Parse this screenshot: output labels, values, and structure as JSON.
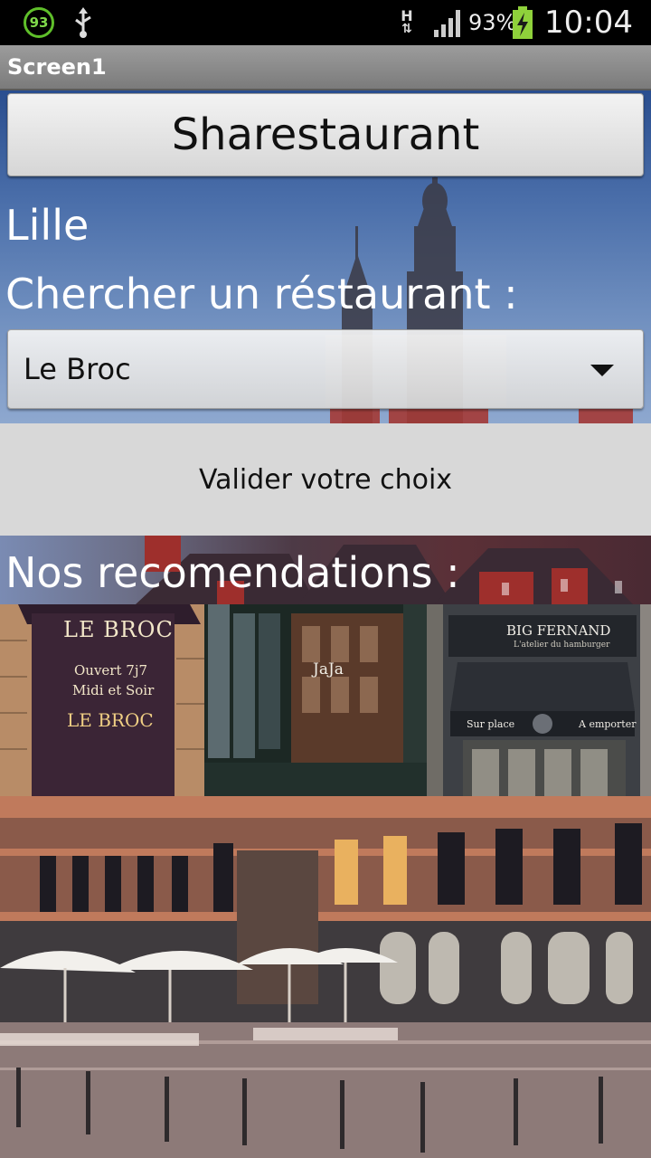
{
  "status_bar": {
    "notification_badge": "93",
    "network_type": "H",
    "battery_percent": "93%",
    "time": "10:04",
    "icons": [
      "usb-icon",
      "signal-icon",
      "battery-charging-icon"
    ]
  },
  "title_bar": {
    "title": "Screen1"
  },
  "main": {
    "app_button_label": "Sharestaurant",
    "city_label": "Lille",
    "search_label": "Chercher un réstaurant :",
    "spinner_value": "Le Broc",
    "validate_button_label": "Valider votre choix",
    "recommendations_label": "Nos recomendations :"
  },
  "thumbnails": {
    "le_broc": {
      "title": "LE BROC",
      "line1": "Ouvert 7j7",
      "line2": "Midi et Soir",
      "line3": "LE BROC"
    },
    "jaja": {
      "sign": "JaJa"
    },
    "big_fernand": {
      "title": "BIG FERNAND",
      "subtitle": "L'atelier du hamburger",
      "left": "Sur place",
      "right": "A emporter"
    }
  },
  "colors": {
    "title_bar": "#8a8a8a",
    "validate_bg": "#d8d8d8",
    "sky": "#4c70ab"
  }
}
